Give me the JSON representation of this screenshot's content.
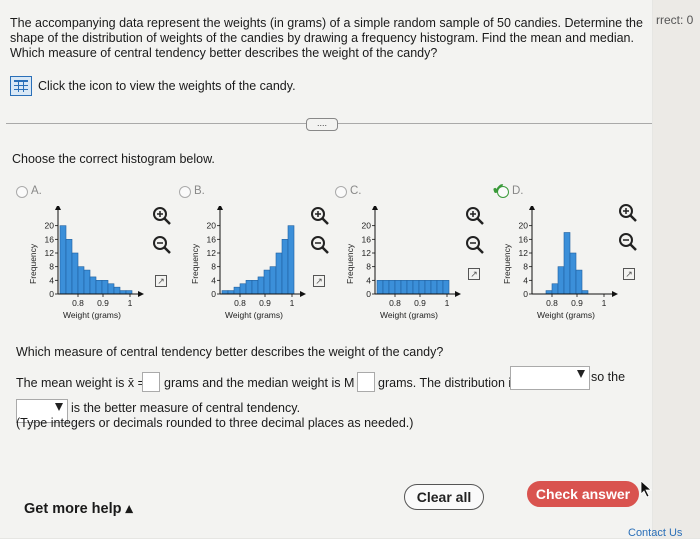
{
  "corner_text": "rrect: 0",
  "question": "The accompanying data represent the weights (in grams) of a simple random sample of 50 candies. Determine the shape of the distribution of weights of the candies by drawing a frequency histogram. Find the mean and median. Which measure of central tendency better describes the weight of the candy?",
  "data_link": "Click the icon to view the weights of the candy.",
  "more_button": "....",
  "choose_prompt": "Choose the correct histogram below.",
  "options": [
    {
      "label": "A.",
      "selected": false
    },
    {
      "label": "B.",
      "selected": false
    },
    {
      "label": "C.",
      "selected": false
    },
    {
      "label": "D.",
      "selected": true
    }
  ],
  "axis": {
    "y_label": "Frequency",
    "x_label": "Weight (grams)"
  },
  "chart_data": [
    {
      "type": "bar",
      "option": "A",
      "ylim": [
        0,
        24
      ],
      "yticks": [
        0,
        4,
        8,
        12,
        16,
        20
      ],
      "xticks": [
        "0.8",
        "0.9",
        "1"
      ],
      "ylabel": "Frequency",
      "xlabel": "Weight (grams)",
      "values": [
        20,
        16,
        12,
        8,
        7,
        5,
        4,
        4,
        3,
        2,
        1,
        1
      ]
    },
    {
      "type": "bar",
      "option": "B",
      "ylim": [
        0,
        24
      ],
      "yticks": [
        0,
        4,
        8,
        12,
        16,
        20
      ],
      "xticks": [
        "0.8",
        "0.9",
        "1"
      ],
      "ylabel": "Frequency",
      "xlabel": "Weight (grams)",
      "values": [
        1,
        1,
        2,
        3,
        4,
        4,
        5,
        7,
        8,
        12,
        16,
        20
      ]
    },
    {
      "type": "bar",
      "option": "C",
      "ylim": [
        0,
        24
      ],
      "yticks": [
        0,
        4,
        8,
        12,
        16,
        20
      ],
      "xticks": [
        "0.8",
        "0.9",
        "1"
      ],
      "ylabel": "Frequency",
      "xlabel": "Weight (grams)",
      "values": [
        4,
        4,
        4,
        4,
        4,
        4,
        4,
        4,
        4,
        4,
        4,
        4
      ]
    },
    {
      "type": "bar",
      "option": "D",
      "ylim": [
        0,
        24
      ],
      "yticks": [
        0,
        4,
        8,
        12,
        16,
        20
      ],
      "xticks": [
        "0.8",
        "0.9",
        "1"
      ],
      "ylabel": "Frequency",
      "xlabel": "Weight (grams)",
      "values": [
        0,
        0,
        1,
        3,
        8,
        18,
        12,
        7,
        1,
        0,
        0,
        0
      ]
    }
  ],
  "measure_question": "Which measure of central tendency better describes the weight of the candy?",
  "mean_prefix": "The mean weight is x̄ =",
  "mean_suffix": "grams and the median weight is M =",
  "median_suffix": "grams. The distribution is",
  "so_the": "so the",
  "better_text": "is the better measure of central tendency.",
  "instructions": "(Type integers or decimals rounded to three decimal places as needed.)",
  "get_more_help": "Get more help ▴",
  "clear_all": "Clear all",
  "check_answer": "Check answer",
  "contact": "Contact Us",
  "colors": {
    "bar_fill": "#3b8fd9",
    "bar_stroke": "#1f5f9e",
    "check_button": "#d9534f",
    "check_mark": "#3a9a3a"
  }
}
